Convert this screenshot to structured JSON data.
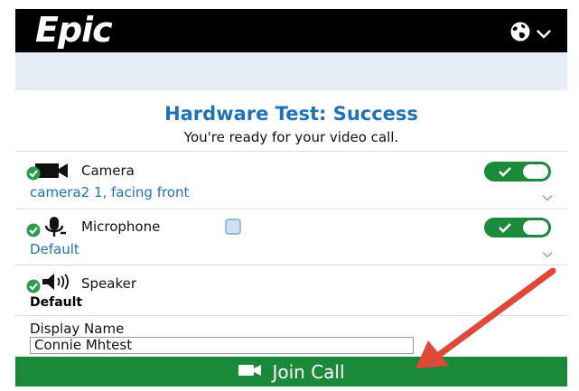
{
  "header": {
    "logo_text": "Epic",
    "language_icon": "globe-icon",
    "chevron_icon": "chevron-down-icon"
  },
  "test": {
    "title": "Hardware Test: Success",
    "subtitle": "You're ready for your video call."
  },
  "devices": {
    "camera": {
      "label": "Camera",
      "selected": "camera2 1, facing front",
      "enabled": true,
      "icon": "camera-icon"
    },
    "microphone": {
      "label": "Microphone",
      "selected": "Default",
      "enabled": true,
      "icon": "microphone-icon"
    },
    "speaker": {
      "label": "Speaker",
      "selected": "Default",
      "icon": "speaker-icon"
    }
  },
  "display_name": {
    "label": "Display Name",
    "value": "Connie Mhtest"
  },
  "join": {
    "label": "Join Call",
    "icon": "video-camera-icon"
  },
  "colors": {
    "accent_blue": "#1f72b8",
    "success_green": "#1b8a3b",
    "annotation_arrow": "#e0493a"
  }
}
